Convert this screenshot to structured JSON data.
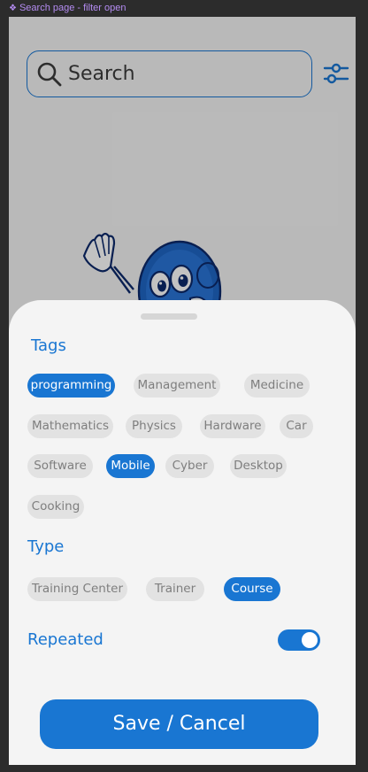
{
  "frame": {
    "label": "Search page - filter open"
  },
  "search": {
    "placeholder": "Search"
  },
  "colors": {
    "accent": "#1976d2",
    "chip_bg": "#e2e2e2",
    "chip_text": "#7e7e7e",
    "sheet_bg": "#f4f4f4"
  },
  "icons": {
    "search": "search-icon",
    "filter": "filter-sliders-icon",
    "mascot": "mascot-illustration",
    "frame": "component-diamond-icon"
  },
  "tags": {
    "title": "Tags",
    "items": [
      {
        "label": "programming",
        "selected": true
      },
      {
        "label": "Management",
        "selected": false
      },
      {
        "label": "Medicine",
        "selected": false
      },
      {
        "label": "Mathematics",
        "selected": false
      },
      {
        "label": "Physics",
        "selected": false
      },
      {
        "label": "Hardware",
        "selected": false
      },
      {
        "label": "Car",
        "selected": false
      },
      {
        "label": "Software",
        "selected": false
      },
      {
        "label": "Mobile",
        "selected": true
      },
      {
        "label": "Cyber",
        "selected": false
      },
      {
        "label": "Desktop",
        "selected": false
      },
      {
        "label": "Cooking",
        "selected": false
      }
    ]
  },
  "type": {
    "title": "Type",
    "items": [
      {
        "label": "Training Center",
        "selected": false
      },
      {
        "label": "Trainer",
        "selected": false
      },
      {
        "label": "Course",
        "selected": true
      }
    ]
  },
  "repeated": {
    "label": "Repeated",
    "on": true
  },
  "save_button": {
    "label": "Save / Cancel"
  }
}
